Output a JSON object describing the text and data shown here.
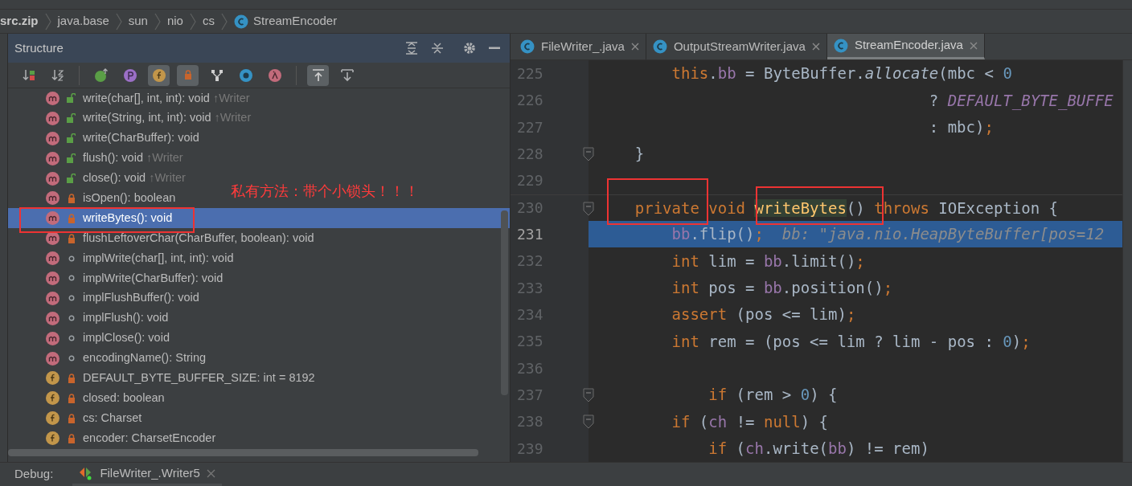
{
  "breadcrumb": [
    {
      "label": "src.zip",
      "kind": "root"
    },
    {
      "label": "java.base",
      "kind": "package"
    },
    {
      "label": "sun",
      "kind": "package"
    },
    {
      "label": "nio",
      "kind": "package"
    },
    {
      "label": "cs",
      "kind": "package"
    },
    {
      "label": "StreamEncoder",
      "kind": "class"
    }
  ],
  "structure": {
    "title": "Structure",
    "toolbar": [
      {
        "selected": false
      },
      {
        "selected": false
      },
      {
        "selected": false
      },
      {
        "selected": false
      },
      {
        "selected": true
      },
      {
        "selected": true
      },
      {
        "selected": false
      },
      {
        "selected": false
      },
      {
        "selected": false
      },
      {
        "selected": true
      },
      {
        "selected": false
      }
    ],
    "items": [
      {
        "text": "write(char[], int, int): void",
        "inherited": "↑Writer",
        "kind": "public_method",
        "selected": false
      },
      {
        "text": "write(String, int, int): void",
        "inherited": "↑Writer",
        "kind": "public_method",
        "selected": false
      },
      {
        "text": "write(CharBuffer): void",
        "kind": "public_method",
        "selected": false
      },
      {
        "text": "flush(): void",
        "inherited": "↑Writer",
        "kind": "public_method",
        "selected": false
      },
      {
        "text": "close(): void",
        "inherited": "↑Writer",
        "kind": "public_method",
        "selected": false
      },
      {
        "text": "isOpen(): boolean",
        "kind": "private_method",
        "selected": false
      },
      {
        "text": "writeBytes(): void",
        "kind": "private_method",
        "selected": true
      },
      {
        "text": "flushLeftoverChar(CharBuffer, boolean): void",
        "kind": "private_method",
        "selected": false
      },
      {
        "text": "implWrite(char[], int, int): void",
        "kind": "package_method",
        "selected": false
      },
      {
        "text": "implWrite(CharBuffer): void",
        "kind": "package_method",
        "selected": false
      },
      {
        "text": "implFlushBuffer(): void",
        "kind": "package_method",
        "selected": false
      },
      {
        "text": "implFlush(): void",
        "kind": "package_method",
        "selected": false
      },
      {
        "text": "implClose(): void",
        "kind": "package_method",
        "selected": false
      },
      {
        "text": "encodingName(): String",
        "kind": "package_method",
        "selected": false
      },
      {
        "text": "DEFAULT_BYTE_BUFFER_SIZE: int = 8192",
        "kind": "private_field",
        "selected": false
      },
      {
        "text": "closed: boolean",
        "kind": "private_field",
        "selected": false
      },
      {
        "text": "cs: Charset",
        "kind": "private_field",
        "selected": false
      },
      {
        "text": "encoder: CharsetEncoder",
        "kind": "private_field",
        "selected": false
      }
    ],
    "annotation": "私有方法：带个小锁头！！！"
  },
  "editor": {
    "tabs": [
      {
        "label": "FileWriter_.java",
        "selected": false
      },
      {
        "label": "OutputStreamWriter.java",
        "selected": false
      },
      {
        "label": "StreamEncoder.java",
        "selected": true
      }
    ],
    "lines": [
      {
        "number": "225",
        "current": false,
        "fold": false,
        "tokens": [
          {
            "text": "        this",
            "kind": "keyword"
          },
          {
            "text": ".",
            "kind": "plain"
          },
          {
            "text": "bb",
            "kind": "field"
          },
          {
            "text": " = ByteBuffer.",
            "kind": "plain"
          },
          {
            "text": "allocate",
            "kind": "italic"
          },
          {
            "text": "(mbc < ",
            "kind": "plain"
          },
          {
            "text": "0",
            "kind": "number"
          }
        ]
      },
      {
        "number": "226",
        "current": false,
        "fold": false,
        "tokens": [
          {
            "text": "                                    ? ",
            "kind": "plain"
          },
          {
            "text": "DEFAULT_BYTE_BUFFE",
            "kind": "constant"
          }
        ]
      },
      {
        "number": "227",
        "current": false,
        "fold": false,
        "tokens": [
          {
            "text": "                                    : mbc)",
            "kind": "plain"
          },
          {
            "text": ";",
            "kind": "keyword"
          }
        ]
      },
      {
        "number": "228",
        "current": false,
        "fold": true,
        "tokens": [
          {
            "text": "    }",
            "kind": "plain"
          }
        ]
      },
      {
        "number": "229",
        "current": false,
        "fold": false
      },
      {
        "number": "230",
        "current": false,
        "fold": true,
        "tokens": [
          {
            "text": "    private void ",
            "kind": "keyword"
          },
          {
            "text": "writeBytes",
            "kind": "match"
          },
          {
            "text": "() ",
            "kind": "plain"
          },
          {
            "text": "throws ",
            "kind": "keyword"
          },
          {
            "text": "IOException {",
            "kind": "plain"
          }
        ]
      },
      {
        "number": "231",
        "current": true,
        "fold": false,
        "tokens": [
          {
            "text": "        bb",
            "kind": "field"
          },
          {
            "text": ".flip()",
            "kind": "plain"
          },
          {
            "text": ";",
            "kind": "keyword"
          },
          {
            "text": "  bb: \"java.nio.HeapByteBuffer[pos=12",
            "kind": "debug"
          }
        ]
      },
      {
        "number": "232",
        "current": false,
        "fold": false,
        "tokens": [
          {
            "text": "        int ",
            "kind": "keyword"
          },
          {
            "text": "lim = ",
            "kind": "plain"
          },
          {
            "text": "bb",
            "kind": "field"
          },
          {
            "text": ".limit()",
            "kind": "plain"
          },
          {
            "text": ";",
            "kind": "keyword"
          }
        ]
      },
      {
        "number": "233",
        "current": false,
        "fold": false,
        "tokens": [
          {
            "text": "        int ",
            "kind": "keyword"
          },
          {
            "text": "pos = ",
            "kind": "plain"
          },
          {
            "text": "bb",
            "kind": "field"
          },
          {
            "text": ".position()",
            "kind": "plain"
          },
          {
            "text": ";",
            "kind": "keyword"
          }
        ]
      },
      {
        "number": "234",
        "current": false,
        "fold": false,
        "tokens": [
          {
            "text": "        assert ",
            "kind": "keyword"
          },
          {
            "text": "(pos <= lim)",
            "kind": "plain"
          },
          {
            "text": ";",
            "kind": "keyword"
          }
        ]
      },
      {
        "number": "235",
        "current": false,
        "fold": false,
        "tokens": [
          {
            "text": "        int ",
            "kind": "keyword"
          },
          {
            "text": "rem = (pos <= lim ? lim - pos : ",
            "kind": "plain"
          },
          {
            "text": "0",
            "kind": "number"
          },
          {
            "text": ")",
            "kind": "plain"
          },
          {
            "text": ";",
            "kind": "keyword"
          }
        ]
      },
      {
        "number": "236",
        "current": false,
        "fold": false
      },
      {
        "number": "237",
        "current": false,
        "fold": true,
        "tokens": [
          {
            "text": "            if ",
            "kind": "keyword"
          },
          {
            "text": "(rem > ",
            "kind": "plain"
          },
          {
            "text": "0",
            "kind": "number"
          },
          {
            "text": ") {",
            "kind": "plain"
          }
        ]
      },
      {
        "number": "238",
        "current": false,
        "fold": true,
        "tokens": [
          {
            "text": "        if ",
            "kind": "keyword"
          },
          {
            "text": "(",
            "kind": "plain"
          },
          {
            "text": "ch",
            "kind": "field"
          },
          {
            "text": " != ",
            "kind": "plain"
          },
          {
            "text": "null",
            "kind": "keyword"
          },
          {
            "text": ") {",
            "kind": "plain"
          }
        ]
      },
      {
        "number": "239",
        "current": false,
        "fold": false,
        "tokens": [
          {
            "text": "            if ",
            "kind": "keyword"
          },
          {
            "text": "(",
            "kind": "plain"
          },
          {
            "text": "ch",
            "kind": "field"
          },
          {
            "text": ".write(",
            "kind": "plain"
          },
          {
            "text": "bb",
            "kind": "field"
          },
          {
            "text": ") != rem)",
            "kind": "plain"
          }
        ]
      }
    ]
  },
  "debug": {
    "label": "Debug:",
    "tab": "FileWriter_.Writer5"
  }
}
